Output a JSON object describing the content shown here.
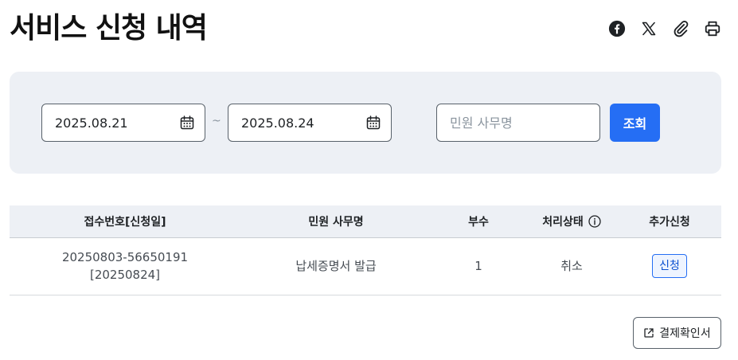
{
  "page": {
    "title": "서비스 신청 내역"
  },
  "share_icons": [
    "facebook-icon",
    "x-icon",
    "link-icon",
    "print-icon"
  ],
  "search": {
    "start_date": "2025.08.21",
    "end_date": "2025.08.24",
    "separator": "~",
    "keyword_placeholder": "민원 사무명",
    "keyword_value": "",
    "submit_label": "조회"
  },
  "table": {
    "headers": [
      "접수번호[신청일]",
      "민원 사무명",
      "부수",
      "처리상태",
      "추가신청"
    ],
    "rows": [
      {
        "receipt_no": "20250803-56650191",
        "apply_date": "[20250824]",
        "service_name": "납세증명서 발급",
        "copies": "1",
        "status": "취소",
        "action": "신청"
      }
    ]
  },
  "footer": {
    "receipt_button": "결제확인서"
  },
  "colors": {
    "primary": "#256ef4",
    "panel_bg": "#edf0f5",
    "text": "#1e2124"
  }
}
